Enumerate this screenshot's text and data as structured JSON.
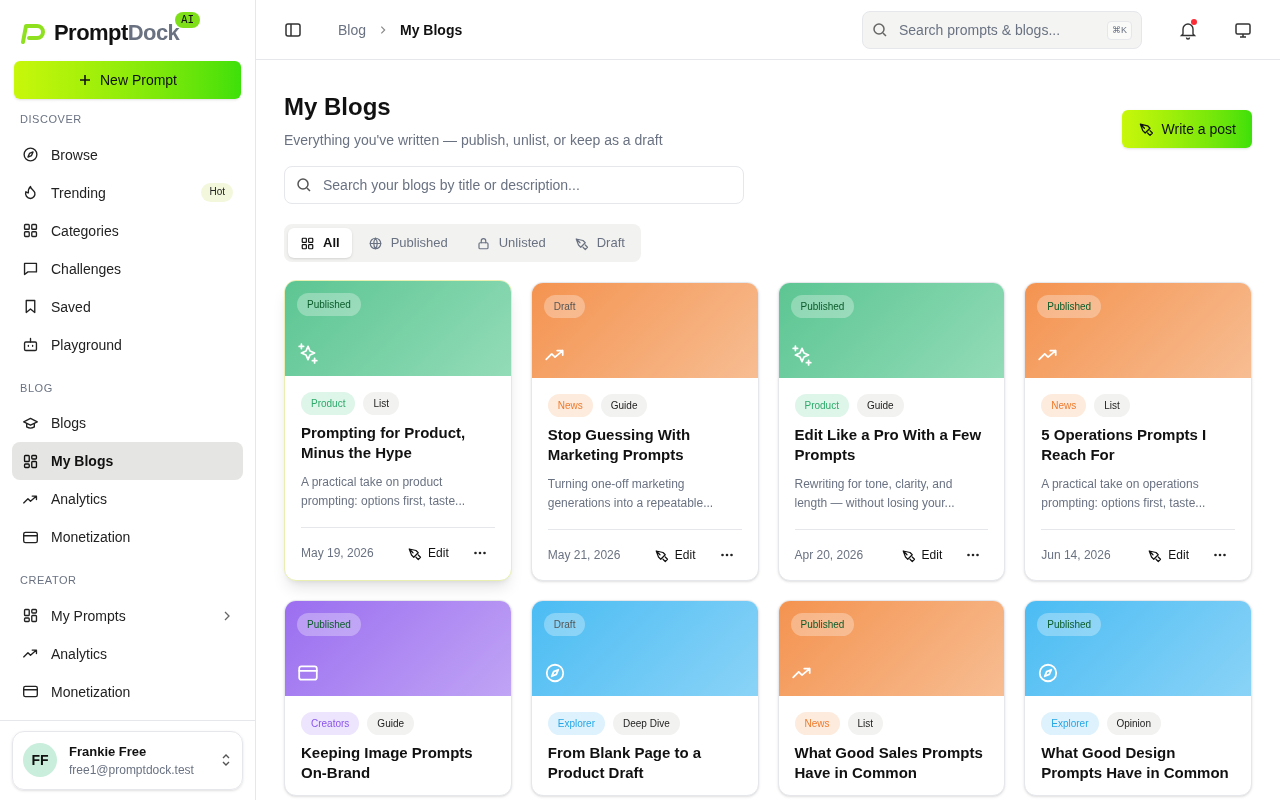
{
  "brand": {
    "name_dark": "Prompt",
    "name_light": "Dock",
    "badge": "AI"
  },
  "new_button": "New Prompt",
  "sidebar": {
    "sections": [
      {
        "title": "DISCOVER",
        "items": [
          {
            "label": "Browse",
            "kind": "compass",
            "selected": false
          },
          {
            "label": "Trending",
            "kind": "flame",
            "selected": false,
            "badge": "Hot"
          },
          {
            "label": "Categories",
            "kind": "grid",
            "selected": false
          },
          {
            "label": "Challenges",
            "kind": "chat",
            "selected": false
          },
          {
            "label": "Saved",
            "kind": "bookmark",
            "selected": false
          },
          {
            "label": "Playground",
            "kind": "bot",
            "selected": false
          }
        ]
      },
      {
        "title": "BLOG",
        "items": [
          {
            "label": "Blogs",
            "kind": "cap",
            "selected": false
          },
          {
            "label": "My Blogs",
            "kind": "dash",
            "selected": true
          },
          {
            "label": "Analytics",
            "kind": "trend",
            "selected": false
          },
          {
            "label": "Monetization",
            "kind": "card",
            "selected": false
          }
        ]
      },
      {
        "title": "CREATOR",
        "items": [
          {
            "label": "My Prompts",
            "kind": "dash",
            "selected": false,
            "chevron": true
          },
          {
            "label": "Analytics",
            "kind": "trend",
            "selected": false
          },
          {
            "label": "Monetization",
            "kind": "card",
            "selected": false
          }
        ]
      }
    ]
  },
  "user": {
    "initials": "FF",
    "name": "Frankie Free",
    "email": "free1@promptdock.test"
  },
  "breadcrumb": [
    "Blog",
    "My Blogs"
  ],
  "top_search": {
    "placeholder": "Search prompts & blogs...",
    "shortcut": "⌘K"
  },
  "notifications": {
    "unread": true
  },
  "page": {
    "title": "My Blogs",
    "subtitle": "Everything you've written — publish, unlist, or keep as a draft",
    "action": "Write a post"
  },
  "blog_search": {
    "placeholder": "Search your blogs by title or description..."
  },
  "filters": [
    {
      "label": "All",
      "kind": "grid",
      "selected": true
    },
    {
      "label": "Published",
      "kind": "globe",
      "selected": false
    },
    {
      "label": "Unlisted",
      "kind": "lock",
      "selected": false
    },
    {
      "label": "Draft",
      "kind": "pen",
      "selected": false
    }
  ],
  "cards": [
    {
      "status": {
        "label": "Published",
        "kind": "published"
      },
      "color": "#5cc592",
      "kind": "sparkles",
      "highlighted": true,
      "tags": [
        "Product",
        "List"
      ],
      "title": "Prompting for Product, Minus the Hype",
      "description": "A practical take on product prompting: options first, taste...",
      "date": "May 19, 2026",
      "edit": "Edit"
    },
    {
      "status": {
        "label": "Draft",
        "kind": "draft"
      },
      "color": "#f49350",
      "kind": "trend",
      "highlighted": false,
      "tags": [
        "News",
        "Guide"
      ],
      "title": "Stop Guessing With Marketing Prompts",
      "description": "Turning one-off marketing generations into a repeatable...",
      "date": "May 21, 2026",
      "edit": "Edit"
    },
    {
      "status": {
        "label": "Published",
        "kind": "published"
      },
      "color": "#5cc592",
      "kind": "sparkles",
      "highlighted": false,
      "tags": [
        "Product",
        "Guide"
      ],
      "title": "Edit Like a Pro With a Few Prompts",
      "description": "Rewriting for tone, clarity, and length — without losing your...",
      "date": "Apr 20, 2026",
      "edit": "Edit"
    },
    {
      "status": {
        "label": "Published",
        "kind": "published"
      },
      "color": "#f49350",
      "kind": "trend",
      "highlighted": false,
      "tags": [
        "News",
        "List"
      ],
      "title": "5 Operations Prompts I Reach For",
      "description": "A practical take on operations prompting: options first, taste...",
      "date": "Jun 14, 2026",
      "edit": "Edit"
    },
    {
      "status": {
        "label": "Published",
        "kind": "published"
      },
      "color": "#9b6ef0",
      "kind": "card",
      "highlighted": false,
      "tags": [
        "Creators",
        "Guide"
      ],
      "title": "Keeping Image Prompts On-Brand"
    },
    {
      "status": {
        "label": "Draft",
        "kind": "draft"
      },
      "color": "#4bbcf3",
      "kind": "compass",
      "highlighted": false,
      "tags": [
        "Explorer",
        "Deep Dive"
      ],
      "title": "From Blank Page to a Product Draft"
    },
    {
      "status": {
        "label": "Published",
        "kind": "published"
      },
      "color": "#f49350",
      "kind": "trend",
      "highlighted": false,
      "tags": [
        "News",
        "List"
      ],
      "title": "What Good Sales Prompts Have in Common"
    },
    {
      "status": {
        "label": "Published",
        "kind": "published"
      },
      "color": "#4bbcf3",
      "kind": "compass",
      "highlighted": false,
      "tags": [
        "Explorer",
        "Opinion"
      ],
      "title": "What Good Design Prompts Have in Common"
    }
  ]
}
